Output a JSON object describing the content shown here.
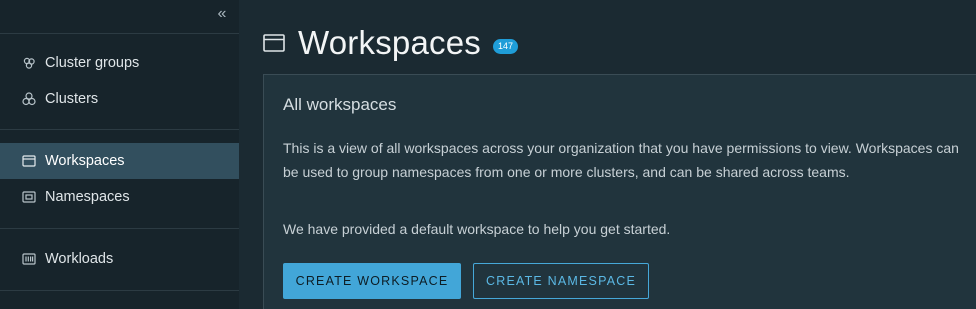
{
  "sidebar": {
    "collapse_icon": "double-chevron-left-icon",
    "items": [
      {
        "label": "Cluster groups",
        "icon": "cluster-groups-icon"
      },
      {
        "label": "Clusters",
        "icon": "clusters-icon"
      },
      {
        "label": "Workspaces",
        "icon": "workspace-window-icon",
        "active": true
      },
      {
        "label": "Namespaces",
        "icon": "namespaces-icon"
      },
      {
        "label": "Workloads",
        "icon": "workloads-icon"
      }
    ]
  },
  "page": {
    "title": "Workspaces",
    "count": "147",
    "title_icon": "workspace-window-icon"
  },
  "card": {
    "title": "All workspaces",
    "description": "This is a view of all workspaces across your organization that you have permissions to view. Workspaces can be used to group namespaces from one or more clusters, and can be shared across teams.",
    "note": "We have provided a default workspace to help you get started.",
    "primary_button": "CREATE WORKSPACE",
    "secondary_button": "CREATE NAMESPACE"
  },
  "colors": {
    "accent": "#42a6d8",
    "active_nav": "#324f5e",
    "background": "#1b2a32"
  }
}
